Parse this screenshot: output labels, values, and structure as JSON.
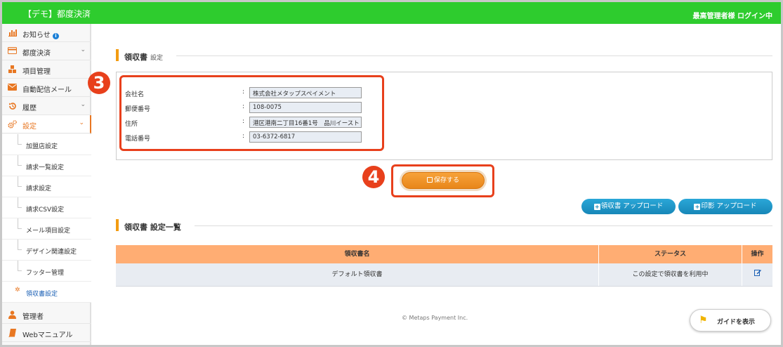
{
  "header": {
    "app_title": "【デモ】都度決済",
    "login_status": "最高管理者様 ログイン中"
  },
  "sidebar": {
    "items": [
      {
        "label": "お知らせ",
        "icon": "bar-chart-icon",
        "badge": "i"
      },
      {
        "label": "都度決済",
        "icon": "credit-card-icon",
        "expandable": true
      },
      {
        "label": "項目管理",
        "icon": "cubes-icon"
      },
      {
        "label": "自動配信メール",
        "icon": "envelope-icon"
      },
      {
        "label": "履歴",
        "icon": "history-icon",
        "expandable": true
      },
      {
        "label": "設定",
        "icon": "gears-icon",
        "expandable": true,
        "active": true
      }
    ],
    "sub_items": [
      {
        "label": "加盟店設定"
      },
      {
        "label": "請求一覧設定"
      },
      {
        "label": "請求設定"
      },
      {
        "label": "請求CSV設定"
      },
      {
        "label": "メール項目設定"
      },
      {
        "label": "デザイン関連設定"
      },
      {
        "label": "フッター管理"
      },
      {
        "label": "領収書設定",
        "active": true
      }
    ],
    "bottom_items": [
      {
        "label": "管理者",
        "icon": "user-icon"
      },
      {
        "label": "Webマニュアル",
        "icon": "book-icon"
      }
    ]
  },
  "section1": {
    "title": "領収書",
    "subtitle": "設定"
  },
  "form": {
    "fields": [
      {
        "label": "会社名",
        "colon": ":",
        "value": "株式会社メタップスペイメント"
      },
      {
        "label": "郵便番号",
        "colon": ":",
        "value": "108-0075"
      },
      {
        "label": "住所",
        "colon": ":",
        "value": "港区港南二丁目16番1号　品川イースト"
      },
      {
        "label": "電話番号",
        "colon": ":",
        "value": "03-6372-6817"
      }
    ]
  },
  "steps": {
    "step3": "3",
    "step4": "4"
  },
  "buttons": {
    "save": "保存する",
    "receipt_upload": "領収書 アップロード",
    "stamp_upload": "印影 アップロード",
    "guide": "ガイドを表示"
  },
  "section2": {
    "title": "領収書 設定一覧"
  },
  "table": {
    "headers": [
      "領収書名",
      "ステータス",
      "操作"
    ],
    "rows": [
      {
        "name": "デフォルト領収書",
        "status": "この設定で領収書を利用中",
        "action_icon": "edit-icon"
      }
    ]
  },
  "footer": {
    "copyright": "© Metaps Payment Inc."
  },
  "colors": {
    "header": "#2ecc2e",
    "accent": "#f39c12",
    "callout": "#e8401c",
    "table_header": "#ffad73",
    "blue_button": "#1787b8"
  }
}
